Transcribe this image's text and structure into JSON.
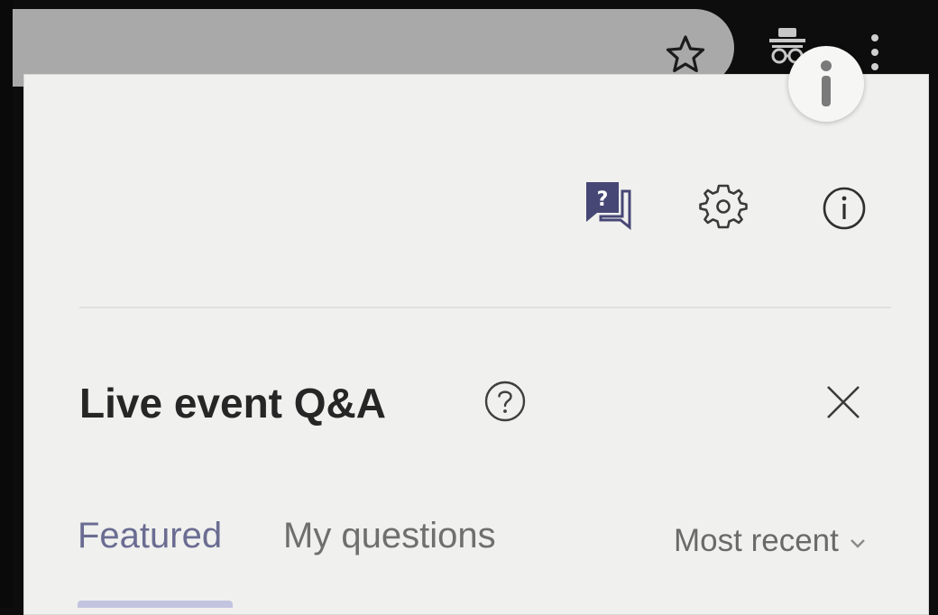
{
  "browser": {
    "icons": {
      "bookmark": "star-outline-icon",
      "extension": "incognito-icon",
      "menu": "three-dots-vertical-icon",
      "info": "info-icon"
    }
  },
  "panel": {
    "toolbar_icons": [
      "qa-chat-icon",
      "gear-icon",
      "info-circle-icon"
    ],
    "title": "Live event Q&A",
    "help_icon": "question-circle-icon",
    "close_icon": "close-icon",
    "tabs": [
      {
        "label": "Featured",
        "selected": true
      },
      {
        "label": "My questions",
        "selected": false
      }
    ],
    "sort": {
      "label": "Most recent",
      "icon": "chevron-down-icon"
    }
  },
  "colors": {
    "panel_background": "#f0f0ee",
    "accent": "#464775",
    "selected_tab_text": "#6a6c92",
    "tab_underline": "#c3c4e0",
    "title_text": "#262626"
  }
}
